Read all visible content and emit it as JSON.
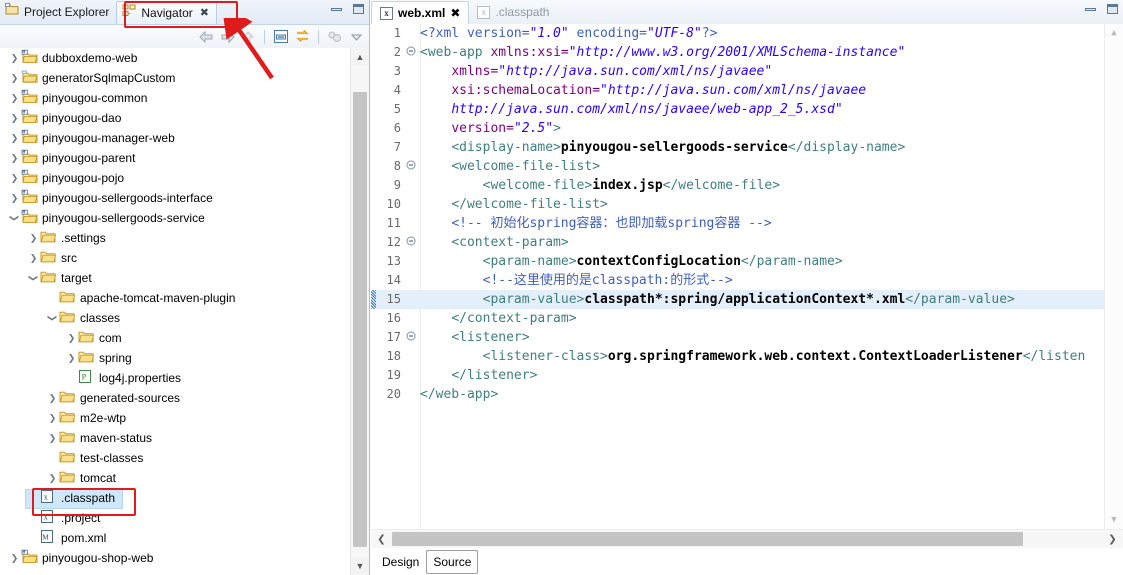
{
  "left_view": {
    "tabs": [
      {
        "label": "Project Explorer",
        "icon": "project-explorer-icon",
        "active": false,
        "closable": false
      },
      {
        "label": "Navigator",
        "icon": "navigator-icon",
        "active": true,
        "closable": true
      }
    ],
    "window_buttons": [
      "minimize",
      "maximize"
    ],
    "toolbar_icons": [
      "back-arrow-icon",
      "forward-arrow-icon",
      "up-arrow-icon",
      "collapse-all-icon",
      "link-with-editor-icon",
      "focus-icon",
      "view-menu-icon"
    ],
    "tree": [
      {
        "label": "dubboxdemo-web",
        "indent": 0,
        "twisty": "collapsed",
        "icon": "maven-project-icon"
      },
      {
        "label": "generatorSqlmapCustom",
        "indent": 0,
        "twisty": "collapsed",
        "icon": "folder-project-icon"
      },
      {
        "label": "pinyougou-common",
        "indent": 0,
        "twisty": "collapsed",
        "icon": "maven-project-icon"
      },
      {
        "label": "pinyougou-dao",
        "indent": 0,
        "twisty": "collapsed",
        "icon": "maven-project-icon"
      },
      {
        "label": "pinyougou-manager-web",
        "indent": 0,
        "twisty": "collapsed",
        "icon": "maven-project-icon"
      },
      {
        "label": "pinyougou-parent",
        "indent": 0,
        "twisty": "collapsed",
        "icon": "maven-project-icon"
      },
      {
        "label": "pinyougou-pojo",
        "indent": 0,
        "twisty": "collapsed",
        "icon": "maven-project-icon"
      },
      {
        "label": "pinyougou-sellergoods-interface",
        "indent": 0,
        "twisty": "collapsed",
        "icon": "maven-project-icon"
      },
      {
        "label": "pinyougou-sellergoods-service",
        "indent": 0,
        "twisty": "expanded",
        "icon": "maven-project-icon"
      },
      {
        "label": ".settings",
        "indent": 1,
        "twisty": "collapsed",
        "icon": "folder-icon"
      },
      {
        "label": "src",
        "indent": 1,
        "twisty": "collapsed",
        "icon": "folder-icon"
      },
      {
        "label": "target",
        "indent": 1,
        "twisty": "expanded",
        "icon": "folder-icon"
      },
      {
        "label": "apache-tomcat-maven-plugin",
        "indent": 2,
        "twisty": "none",
        "icon": "folder-icon"
      },
      {
        "label": "classes",
        "indent": 2,
        "twisty": "expanded",
        "icon": "folder-icon"
      },
      {
        "label": "com",
        "indent": 3,
        "twisty": "collapsed",
        "icon": "folder-icon"
      },
      {
        "label": "spring",
        "indent": 3,
        "twisty": "collapsed",
        "icon": "folder-icon"
      },
      {
        "label": "log4j.properties",
        "indent": 3,
        "twisty": "none",
        "icon": "properties-file-icon"
      },
      {
        "label": "generated-sources",
        "indent": 2,
        "twisty": "collapsed",
        "icon": "folder-icon"
      },
      {
        "label": "m2e-wtp",
        "indent": 2,
        "twisty": "collapsed",
        "icon": "folder-icon"
      },
      {
        "label": "maven-status",
        "indent": 2,
        "twisty": "collapsed",
        "icon": "folder-icon"
      },
      {
        "label": "test-classes",
        "indent": 2,
        "twisty": "none",
        "icon": "folder-icon"
      },
      {
        "label": "tomcat",
        "indent": 2,
        "twisty": "collapsed",
        "icon": "folder-icon"
      },
      {
        "label": ".classpath",
        "indent": 1,
        "twisty": "none",
        "icon": "xml-file-icon",
        "selected": true
      },
      {
        "label": ".project",
        "indent": 1,
        "twisty": "none",
        "icon": "xml-file-icon"
      },
      {
        "label": "pom.xml",
        "indent": 1,
        "twisty": "none",
        "icon": "maven-pom-icon"
      },
      {
        "label": "pinyougou-shop-web",
        "indent": 0,
        "twisty": "collapsed",
        "icon": "maven-project-icon"
      }
    ]
  },
  "editor": {
    "tabs": [
      {
        "label": "web.xml",
        "icon": "xml-file-icon",
        "active": true,
        "closable": true
      },
      {
        "label": ".classpath",
        "icon": "xml-file-icon",
        "active": false,
        "closable": false
      }
    ],
    "window_buttons": [
      "minimize",
      "maximize"
    ],
    "highlighted_line": 15,
    "bottom_tabs": [
      {
        "label": "Design",
        "selected": false
      },
      {
        "label": "Source",
        "selected": true
      }
    ],
    "lines": [
      {
        "n": "1",
        "fold": "",
        "html": "<span class=\"pi\">&lt;?xml version=</span><span class=\"val\">\"1.0\"</span><span class=\"pi\"> encoding=</span><span class=\"val\">\"UTF-8\"</span><span class=\"pi\">?&gt;</span>"
      },
      {
        "n": "2",
        "fold": "-",
        "html": "<span class=\"tag\">&lt;web-app </span><span class=\"attr\">xmlns:xsi=</span><span class=\"val\">\"http://www.w3.org/2001/XMLSchema-instance\"</span>"
      },
      {
        "n": "3",
        "fold": "",
        "html": "    <span class=\"attr\">xmlns=</span><span class=\"val\">\"http://java.sun.com/xml/ns/javaee\"</span>"
      },
      {
        "n": "4",
        "fold": "",
        "html": "    <span class=\"attr\">xsi:schemaLocation=</span><span class=\"val\">\"http://java.sun.com/xml/ns/javaee</span>"
      },
      {
        "n": "5",
        "fold": "",
        "html": "    <span class=\"val\">http://java.sun.com/xml/ns/javaee/web-app_2_5.xsd\"</span>"
      },
      {
        "n": "6",
        "fold": "",
        "html": "    <span class=\"attr\">version=</span><span class=\"val\">\"2.5\"</span><span class=\"tag\">&gt;</span>"
      },
      {
        "n": "7",
        "fold": "",
        "html": "    <span class=\"tag\">&lt;display-name&gt;</span><span class=\"txt\">pinyougou-sellergoods-service</span><span class=\"tag\">&lt;/display-name&gt;</span>"
      },
      {
        "n": "8",
        "fold": "-",
        "html": "    <span class=\"tag\">&lt;welcome-file-list&gt;</span>"
      },
      {
        "n": "9",
        "fold": "",
        "html": "        <span class=\"tag\">&lt;welcome-file&gt;</span><span class=\"txt\">index.jsp</span><span class=\"tag\">&lt;/welcome-file&gt;</span>"
      },
      {
        "n": "10",
        "fold": "",
        "html": "    <span class=\"tag\">&lt;/welcome-file-list&gt;</span>"
      },
      {
        "n": "11",
        "fold": "",
        "html": "    <span class=\"cmt\">&lt;!-- 初始化spring容器：也即加载spring容器 --&gt;</span>"
      },
      {
        "n": "12",
        "fold": "-",
        "html": "    <span class=\"tag\">&lt;context-param&gt;</span>"
      },
      {
        "n": "13",
        "fold": "",
        "html": "        <span class=\"tag\">&lt;param-name&gt;</span><span class=\"txt\">contextConfigLocation</span><span class=\"tag\">&lt;/param-name&gt;</span>"
      },
      {
        "n": "14",
        "fold": "",
        "html": "        <span class=\"cmt\">&lt;!--这里使用的是classpath:的形式--&gt;</span>"
      },
      {
        "n": "15",
        "fold": "",
        "html": "        <span class=\"tag\">&lt;param-value&gt;</span><span class=\"txt\">classpath*:spring/applicationContext*.xml</span><span class=\"tag\">&lt;/param-value&gt;</span>"
      },
      {
        "n": "16",
        "fold": "",
        "html": "    <span class=\"tag\">&lt;/context-param&gt;</span>"
      },
      {
        "n": "17",
        "fold": "-",
        "html": "    <span class=\"tag\">&lt;listener&gt;</span>"
      },
      {
        "n": "18",
        "fold": "",
        "html": "        <span class=\"tag\">&lt;listener-class&gt;</span><span class=\"txt\">org.springframework.web.context.ContextLoaderListener</span><span class=\"tag\">&lt;/listen</span>"
      },
      {
        "n": "19",
        "fold": "",
        "html": "    <span class=\"tag\">&lt;/listener&gt;</span>"
      },
      {
        "n": "20",
        "fold": "",
        "html": "<span class=\"tag\">&lt;/web-app&gt;</span>"
      }
    ]
  },
  "annotations": {
    "color": "#e01b1b",
    "rect_navigator_tab": "Navigator tab highlighted",
    "rect_classpath_item": ".classpath tree item highlighted",
    "arrow": "arrow pointing at Navigator tab"
  }
}
